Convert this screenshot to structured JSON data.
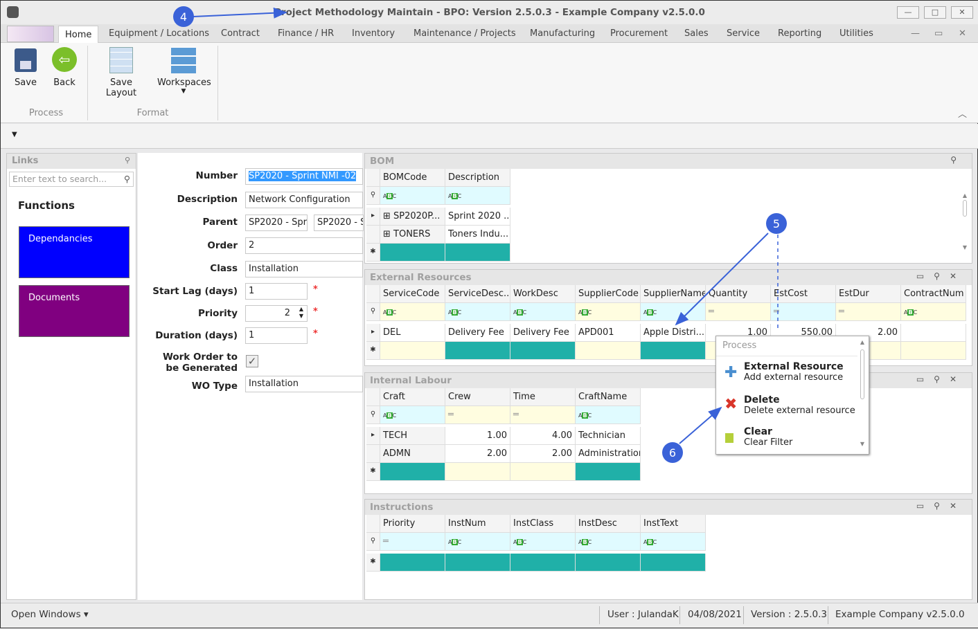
{
  "window": {
    "title": "Project Methodology Maintain - BPO: Version 2.5.0.3 - Example Company v2.5.0.0",
    "min": "—",
    "max": "□",
    "close": "✕"
  },
  "tabs": [
    "Home",
    "Equipment / Locations",
    "Contract",
    "Finance / HR",
    "Inventory",
    "Maintenance / Projects",
    "Manufacturing",
    "Procurement",
    "Sales",
    "Service",
    "Reporting",
    "Utilities"
  ],
  "ribbon": {
    "save": "Save",
    "back": "Back",
    "save_layout": "Save Layout",
    "workspaces": "Workspaces",
    "group_process": "Process",
    "group_format": "Format"
  },
  "links": {
    "title": "Links",
    "search_placeholder": "Enter text to search...",
    "functions": "Functions",
    "tiles": [
      {
        "label": "Dependancies",
        "color": "#0000ff"
      },
      {
        "label": "Documents",
        "color": "#800080"
      }
    ]
  },
  "form": {
    "number": {
      "label": "Number",
      "value": "SP2020 - Sprint NMI -02"
    },
    "description": {
      "label": "Description",
      "value": "Network Configuration"
    },
    "parent": {
      "label": "Parent",
      "value1": "SP2020 - Sprint",
      "value2": "SP2020 - Sprint"
    },
    "order": {
      "label": "Order",
      "value": "2"
    },
    "class": {
      "label": "Class",
      "value": "Installation"
    },
    "start_lag": {
      "label": "Start Lag (days)",
      "value": "1"
    },
    "priority": {
      "label": "Priority",
      "value": "2"
    },
    "duration": {
      "label": "Duration (days)",
      "value": "1"
    },
    "wo_generated": {
      "label1": "Work Order to",
      "label2": "be Generated",
      "checked": true
    },
    "wo_type": {
      "label": "WO Type",
      "value": "Installation"
    },
    "required_mark": "*"
  },
  "grids": [
    {
      "id": "bom",
      "title": "BOM",
      "columns": [
        {
          "label": "BOMCode",
          "filter": "abc",
          "bg": "#e0fbff",
          "new": "#20b0a8"
        },
        {
          "label": "Description",
          "filter": "abc",
          "bg": "#e0fbff",
          "new": "#20b0a8"
        }
      ],
      "rows": [
        {
          "ind": "▸",
          "cells": [
            "⊞ SP2020P...",
            "Sprint 2020 ..."
          ]
        },
        {
          "ind": "",
          "cells": [
            "⊞ TONERS",
            "Toners Indu..."
          ]
        }
      ]
    },
    {
      "id": "ext",
      "title": "External Resources",
      "columns": [
        {
          "label": "ServiceCode",
          "filter": "abc",
          "bg": "#fffde0",
          "new": "#fffde0"
        },
        {
          "label": "ServiceDesc...",
          "filter": "abc",
          "bg": "#e0fbff",
          "new": "#20b0a8"
        },
        {
          "label": "WorkDesc",
          "filter": "abc",
          "bg": "#e0fbff",
          "new": "#20b0a8"
        },
        {
          "label": "SupplierCode",
          "filter": "abc",
          "bg": "#fffde0",
          "new": "#fffde0"
        },
        {
          "label": "SupplierName",
          "filter": "abc",
          "bg": "#e0fbff",
          "new": "#20b0a8"
        },
        {
          "label": "Quantity",
          "filter": "eq",
          "bg": "#fffde0",
          "new": "#fffde0",
          "num": true
        },
        {
          "label": "EstCost",
          "filter": "eq",
          "bg": "#e0fbff",
          "new": "#fffde0",
          "num": true
        },
        {
          "label": "EstDur",
          "filter": "eq",
          "bg": "#fffde0",
          "new": "#fffde0",
          "num": true
        },
        {
          "label": "ContractNum",
          "filter": "abc",
          "bg": "#fffde0",
          "new": "#fffde0"
        }
      ],
      "rows": [
        {
          "ind": "▸",
          "cells": [
            "DEL",
            "Delivery Fee",
            "Delivery Fee",
            "APD001",
            "Apple Distri...",
            "1.00",
            "550.00",
            "2.00",
            ""
          ]
        }
      ]
    },
    {
      "id": "lab",
      "title": "Internal Labour",
      "columns": [
        {
          "label": "Craft",
          "filter": "abc",
          "bg": "#e0fbff",
          "new": "#20b0a8"
        },
        {
          "label": "Crew",
          "filter": "eq",
          "bg": "#fffde0",
          "new": "#fffde0",
          "num": true
        },
        {
          "label": "Time",
          "filter": "eq",
          "bg": "#fffde0",
          "new": "#fffde0",
          "num": true
        },
        {
          "label": "CraftName",
          "filter": "abc",
          "bg": "#e0fbff",
          "new": "#20b0a8"
        }
      ],
      "rows": [
        {
          "ind": "▸",
          "cells": [
            "TECH",
            "1.00",
            "4.00",
            "Technician"
          ]
        },
        {
          "ind": "",
          "cells": [
            "ADMN",
            "2.00",
            "2.00",
            "Administration"
          ]
        }
      ]
    },
    {
      "id": "ins",
      "title": "Instructions",
      "columns": [
        {
          "label": "Priority",
          "filter": "eq",
          "bg": "#e0fbff",
          "new": "#20b0a8"
        },
        {
          "label": "InstNum",
          "filter": "abc",
          "bg": "#e0fbff",
          "new": "#20b0a8"
        },
        {
          "label": "InstClass",
          "filter": "abc",
          "bg": "#e0fbff",
          "new": "#20b0a8"
        },
        {
          "label": "InstDesc",
          "filter": "abc",
          "bg": "#e0fbff",
          "new": "#20b0a8"
        },
        {
          "label": "InstText",
          "filter": "abc",
          "bg": "#e0fbff",
          "new": "#20b0a8"
        }
      ],
      "rows": []
    }
  ],
  "context_menu": {
    "header": "Process",
    "items": [
      {
        "title": "External Resource",
        "subtitle": "Add external resource",
        "icon": "add-icon"
      },
      {
        "title": "Delete",
        "subtitle": "Delete external resource",
        "icon": "delete-icon"
      },
      {
        "title": "Clear",
        "subtitle": "Clear Filter",
        "icon": "clear-filter-icon"
      }
    ]
  },
  "callouts": [
    "4",
    "5",
    "6"
  ],
  "status": {
    "open_windows": "Open Windows ▾",
    "user": "User : JulandaK",
    "date": "04/08/2021",
    "version": "Version : 2.5.0.3",
    "company": "Example Company v2.5.0.0"
  }
}
